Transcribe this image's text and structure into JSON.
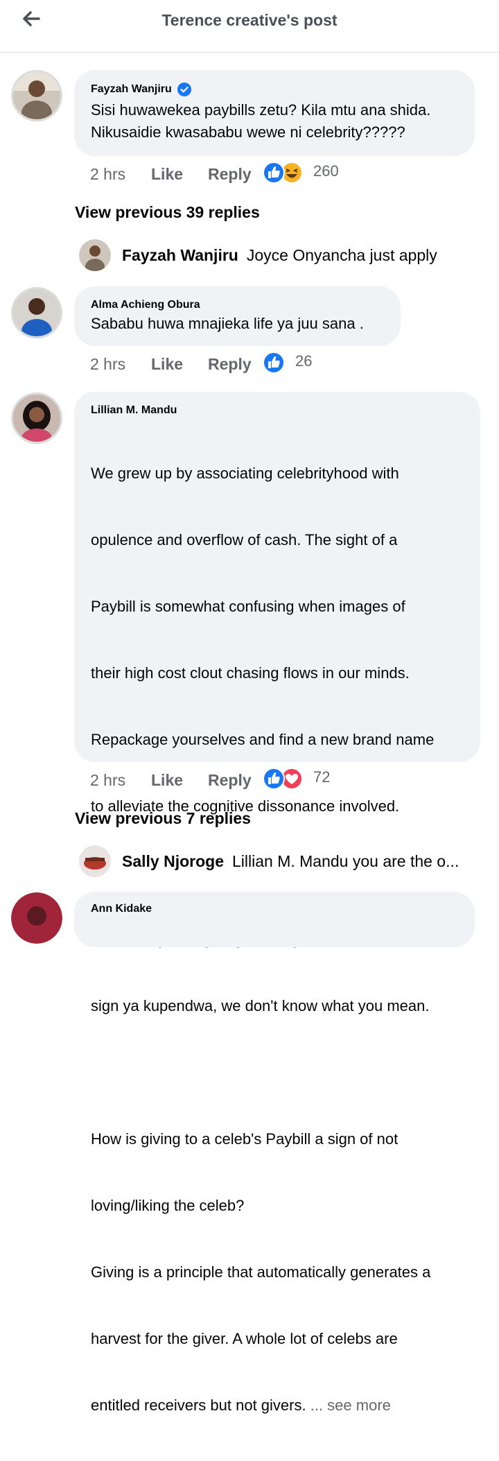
{
  "header": {
    "title": "Terence creative's post"
  },
  "comments": [
    {
      "author": "Fayzah Wanjiru",
      "verified": true,
      "text": "Sisi huwawekea paybills zetu? Kila mtu ana shida. Nikusaidie kwasababu wewe ni celebrity?????",
      "time": "2 hrs",
      "like": "Like",
      "reply": "Reply",
      "reactions": [
        "like-icon",
        "haha-icon"
      ],
      "reaction_count": "260",
      "view_previous": "View previous 39 replies",
      "reply_preview": {
        "author": "Fayzah Wanjiru",
        "text": "Joyce Onyancha just apply"
      }
    },
    {
      "author": "Alma Achieng Obura",
      "text": "Sababu huwa mnajieka life ya juu sana .",
      "time": "2 hrs",
      "like": "Like",
      "reply": "Reply",
      "reactions": [
        "like-icon"
      ],
      "reaction_count": "26"
    },
    {
      "author": "Lillian M. Mandu",
      "text_lines": [
        "We grew up by associating celebrityhood with",
        "opulence and overflow of cash. The sight of a",
        "Paybill is somewhat confusing when images of",
        "their high cost clout chasing flows in our minds.",
        "Repackage yourselves and find a new brand name",
        "to alleviate the cognitive dissonance involved.",
        "",
        "If the many likes you get then you monetize isn't a",
        "sign ya kupendwa, we don't know what you mean.",
        "",
        "How is giving to a celeb's Paybill a sign of not",
        "loving/liking the celeb?",
        "Giving is a principle that automatically generates a",
        "harvest for the giver. A whole lot of celebs are",
        "entitled receivers but not givers."
      ],
      "see_more": "... see more",
      "time": "2 hrs",
      "like": "Like",
      "reply": "Reply",
      "reactions": [
        "like-icon",
        "love-icon"
      ],
      "reaction_count": "72",
      "view_previous": "View previous 7 replies",
      "reply_preview": {
        "author": "Sally Njoroge",
        "text": "Lillian M. Mandu you are the o..."
      }
    },
    {
      "author": "Ann Kidake"
    }
  ],
  "colors": {
    "like": "#1877f2",
    "love": "#f33e58",
    "haha": "#f7b125",
    "bubble": "#f0f2f5",
    "muted": "#65676b"
  }
}
